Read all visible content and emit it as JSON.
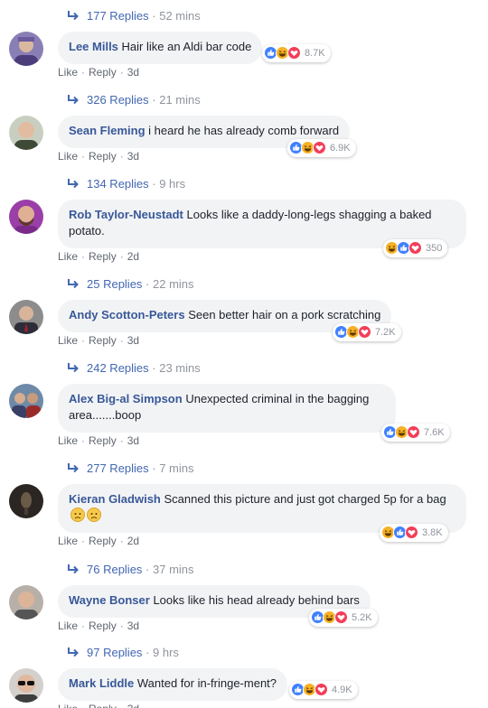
{
  "reply_threads": [
    {
      "count": "177 Replies",
      "time": "52 mins"
    },
    {
      "count": "326 Replies",
      "time": "21 mins"
    },
    {
      "count": "134 Replies",
      "time": "9 hrs"
    },
    {
      "count": "25 Replies",
      "time": "22 mins"
    },
    {
      "count": "242 Replies",
      "time": "23 mins"
    },
    {
      "count": "277 Replies",
      "time": "7 mins"
    },
    {
      "count": "76 Replies",
      "time": "37 mins"
    },
    {
      "count": "97 Replies",
      "time": "9 hrs"
    }
  ],
  "actions": {
    "like": "Like",
    "reply": "Reply",
    "separator": "·"
  },
  "colors": {
    "like": "#4080ff",
    "haha": "#f7b125",
    "love": "#f33e58",
    "link": "#385898"
  },
  "comments": [
    {
      "name": "Lee Mills",
      "text": "Hair like an Aldi bar code",
      "age": "3d",
      "reaction_count": "8.7K",
      "reactions": [
        "like-icon",
        "haha-icon",
        "love-icon"
      ],
      "avatar": "avatar-purple"
    },
    {
      "name": "Sean Fleming",
      "text": "i heard he has already comb forward",
      "age": "3d",
      "reaction_count": "6.9K",
      "reactions": [
        "like-icon",
        "haha-icon",
        "love-icon"
      ],
      "avatar": "avatar-bald"
    },
    {
      "name": "Rob Taylor-Neustadt",
      "text": "Looks like a daddy-long-legs shagging a baked potato.",
      "age": "2d",
      "reaction_count": "350",
      "reactions": [
        "haha-icon",
        "like-icon",
        "love-icon"
      ],
      "avatar": "avatar-purple-beard"
    },
    {
      "name": "Andy Scotton-Peters",
      "text": "Seen better hair on a pork scratching",
      "age": "3d",
      "reaction_count": "7.2K",
      "reactions": [
        "like-icon",
        "haha-icon",
        "love-icon"
      ],
      "avatar": "avatar-suit"
    },
    {
      "name": "Alex Big-al Simpson",
      "text": "Unexpected criminal in the bagging area.......boop",
      "age": "3d",
      "reaction_count": "7.6K",
      "reactions": [
        "like-icon",
        "haha-icon",
        "love-icon"
      ],
      "avatar": "avatar-group"
    },
    {
      "name": "Kieran Gladwish",
      "text": "Scanned this picture and just got charged 5p for a bag",
      "age": "2d",
      "reaction_count": "3.8K",
      "reactions": [
        "haha-icon",
        "like-icon",
        "love-icon"
      ],
      "avatar": "avatar-dark"
    },
    {
      "name": "Wayne Bonser",
      "text": "Looks like his head already behind bars",
      "age": "3d",
      "reaction_count": "5.2K",
      "reactions": [
        "like-icon",
        "haha-icon",
        "love-icon"
      ],
      "avatar": "avatar-man"
    },
    {
      "name": "Mark Liddle",
      "text": "Wanted for in-fringe-ment?",
      "age": "3d",
      "reaction_count": "4.9K",
      "reactions": [
        "like-icon",
        "haha-icon",
        "love-icon"
      ],
      "avatar": "avatar-sunglasses"
    }
  ]
}
